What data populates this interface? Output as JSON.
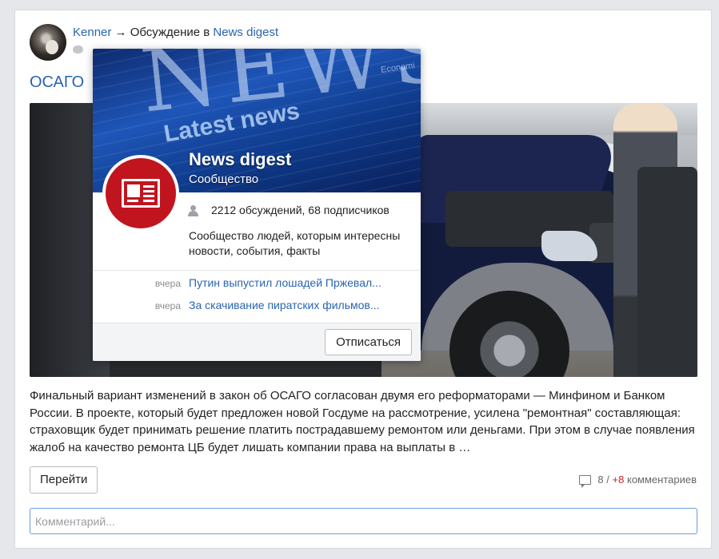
{
  "post": {
    "author": "Kenner",
    "arrow": "→",
    "context_prefix": "Обсуждение в",
    "community": "News digest",
    "title": "ОСАГО",
    "body": "Финальный вариант изменений в закон об ОСАГО согласован двумя его реформаторами — Минфином и Банком России. В проекте, который будет предложен новой Госдуме на рассмотрение, усилена \"ремонтная\" составляющая: страховщик будет принимать решение платить пострадавшему ремонтом или деньгами. При этом в случае появления жалоб на качество ремонта ЦБ будет лишать компании права на выплаты в …",
    "go_button": "Перейти",
    "comments_count": "8",
    "comments_separator": "/",
    "comments_new": "+8",
    "comments_label": "комментариев",
    "comment_placeholder": "Комментарий..."
  },
  "popup": {
    "cover_word": "NEWS",
    "cover_headline": "Latest news",
    "cover_small": "Economi",
    "name": "News digest",
    "type": "Сообщество",
    "stats": "2212 обсуждений, 68 подписчиков",
    "description": "Сообщество людей, которым интересны новости, события, факты",
    "news": [
      {
        "time": "вчера",
        "title": "Путин выпустил лошадей Пржевал..."
      },
      {
        "time": "вчера",
        "title": "За скачивание пиратских фильмов..."
      }
    ],
    "unsubscribe": "Отписаться"
  },
  "colors": {
    "link": "#2a64b0",
    "accent_red": "#cc1f2b",
    "logo_red": "#c0151f",
    "input_border": "#6d9bd8"
  },
  "icons": {
    "avatar": "user-avatar",
    "meta": "comment-bubble-icon",
    "logo": "newspaper-icon",
    "stats": "users-icon",
    "comments": "comment-icon"
  }
}
